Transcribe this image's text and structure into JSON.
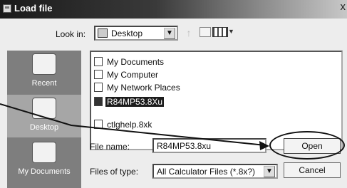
{
  "window": {
    "title": "Load file",
    "close_label": "x"
  },
  "toolbar": {
    "look_in_label": "Look in:",
    "look_in_value": "Desktop",
    "combo_arrow": "▼",
    "up_icon": "↑",
    "view_arrow": "▼"
  },
  "places": [
    {
      "label": "Recent",
      "icon": "recent-folder-icon"
    },
    {
      "label": "Desktop",
      "icon": "desktop-icon"
    },
    {
      "label": "My Documents",
      "icon": "my-documents-icon"
    }
  ],
  "files": [
    {
      "name": "My Documents",
      "icon": "folder-icon"
    },
    {
      "name": "My Computer",
      "icon": "computer-icon"
    },
    {
      "name": "My Network Places",
      "icon": "network-icon"
    },
    {
      "name": "R84MP53.8Xu",
      "icon": "calculator-file-icon",
      "selected": true
    },
    {
      "name": "ctlghelp.8xk",
      "icon": "calculator-file-icon"
    }
  ],
  "form": {
    "file_name_label": "File name:",
    "file_name_value": "R84MP53.8xu",
    "file_type_label": "Files of type:",
    "file_type_value": "All Calculator Files (*.8x?)",
    "file_type_arrow": "▼"
  },
  "buttons": {
    "open": "Open",
    "cancel": "Cancel"
  }
}
